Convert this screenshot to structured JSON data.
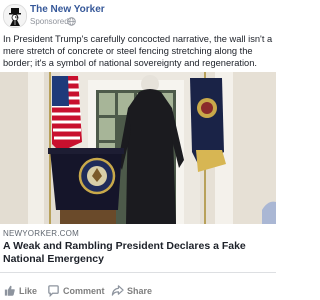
{
  "post": {
    "page_name": "The New Yorker",
    "sponsored_label": "Sponsored",
    "privacy_icon": "globe-icon",
    "text": "In President Trump's carefully concocted narrative, the wall isn't a mere stretch of concrete or steel fencing stretching along the border; it's a symbol of national sovereignty and regeneration.",
    "link": {
      "source": "NEWYORKER.COM",
      "headline": "A Weak and Rambling President Declares a Fake National Emergency"
    },
    "actions": [
      {
        "label": "Like",
        "icon": "thumbs-up-icon"
      },
      {
        "label": "Comment",
        "icon": "comment-icon"
      },
      {
        "label": "Share",
        "icon": "share-icon"
      }
    ]
  },
  "colors": {
    "page_name": "#365899",
    "action_text": "#7f7f7f"
  }
}
